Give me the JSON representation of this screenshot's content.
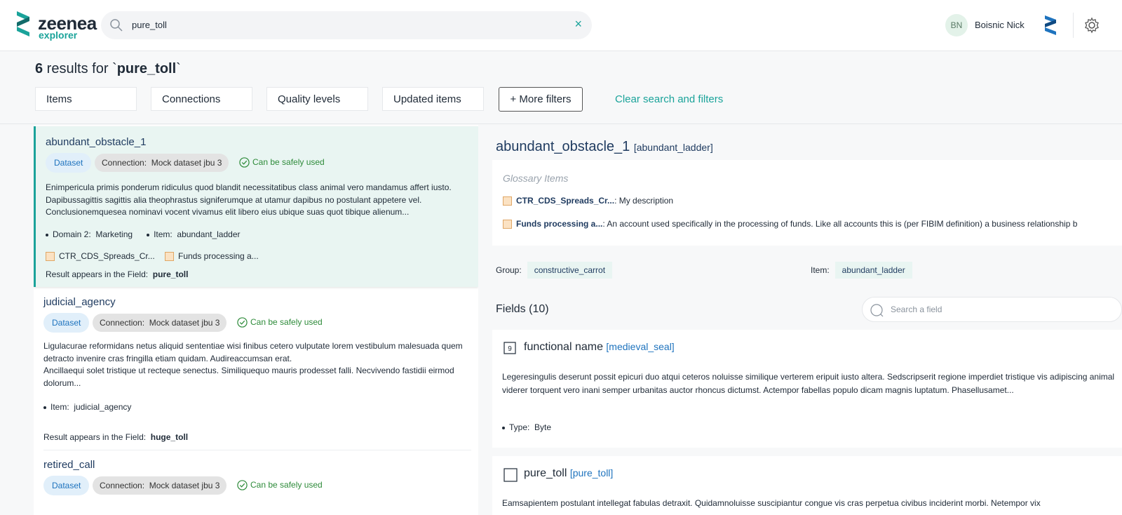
{
  "brand": {
    "name": "zeenea",
    "sub": "explorer"
  },
  "search": {
    "value": "pure_toll",
    "clear_glyph": "×"
  },
  "user": {
    "initials": "BN",
    "name": "Boisnic Nick"
  },
  "results": {
    "count": "6",
    "prefix": " results for `",
    "query": "pure_toll",
    "suffix": "`"
  },
  "filters": [
    "Items",
    "Connections",
    "Quality levels",
    "Updated items"
  ],
  "more_filters": "+ More filters",
  "clear_filters": "Clear search and filters",
  "labels": {
    "appears": "Result appears in the Field:",
    "connection": "Connection:",
    "domain": "Domain 2:",
    "item": "Item:",
    "group": "Group:",
    "type": "Type:",
    "search_field": "Search a field"
  },
  "list": [
    {
      "title": "abundant_obstacle_1",
      "badge": "Dataset",
      "connection": "Mock dataset jbu 3",
      "status": "Can be safely used",
      "description": "Enimpericula primis ponderum ridiculus quod blandit necessitatibus class animal vero mandamus affert iusto. Dapibussagittis sagittis alia theophrastus signiferumque at utamur dapibus no postulant appetere vel. Conclusionemquesea nominavi vocent vivamus elit libero eius ubique suas quot tibique alienum...",
      "domain": "Marketing",
      "item": "abundant_ladder",
      "glossary": [
        "CTR_CDS_Spreads_Cr...",
        "Funds processing a..."
      ],
      "field": "pure_toll"
    },
    {
      "title": "judicial_agency",
      "badge": "Dataset",
      "connection": "Mock dataset jbu 3",
      "status": "Can be safely used",
      "description1": "Ligulacurae reformidans netus aliquid sententiae wisi finibus cetero vulputate lorem vestibulum malesuada quem detracto invenire cras fringilla etiam quidam. Audireaccumsan erat.",
      "description2": "Ancillaequi solet tristique ut recteque senectus. Similiquequo mauris prodesset falli. Necvivendo fastidii eirmod dolorum...",
      "item": "judicial_agency",
      "field": "huge_toll"
    },
    {
      "title": "retired_call",
      "badge": "Dataset",
      "connection": "Mock dataset jbu 3",
      "status": "Can be safely used"
    }
  ],
  "detail": {
    "title": "abundant_obstacle_1",
    "alias": "[abundant_ladder]",
    "glossary_header": "Glossary Items",
    "glossary": [
      {
        "name": "CTR_CDS_Spreads_Cr...",
        "desc": ": My description"
      },
      {
        "name": "Funds processing a...",
        "desc": ": An account used specifically in the processing of funds. Like all accounts this is (per FIBIM definition) a business relationship b"
      }
    ],
    "group": "constructive_carrot",
    "item": "abundant_ladder",
    "fields_header": "Fields (10)",
    "fields": [
      {
        "name": "functional name",
        "alias": "[medieval_seal]",
        "description": "Legeresingulis deserunt possit epicuri duo atqui ceteros noluisse similique verterem eripuit iusto altera. Sedscripserit regione imperdiet tristique vis adipiscing animal viderer torquent vero inani semper urbanitas auctor rhoncus dictumst. Actempor fabellas populo dicam magnis luptatum. Phasellusamet...",
        "type": "Byte"
      },
      {
        "name": "pure_toll",
        "alias": "[pure_toll]",
        "description": "Eamsapientem postulant intellegat fabulas detraxit. Quidamnoluisse suscipiantur congue vis cras perpetua civibus inciderint morbi. Netempor vix"
      }
    ]
  },
  "colors": {
    "accent": "#1aa39a",
    "link": "#1e3a5f",
    "ok": "#2e8b3a"
  }
}
